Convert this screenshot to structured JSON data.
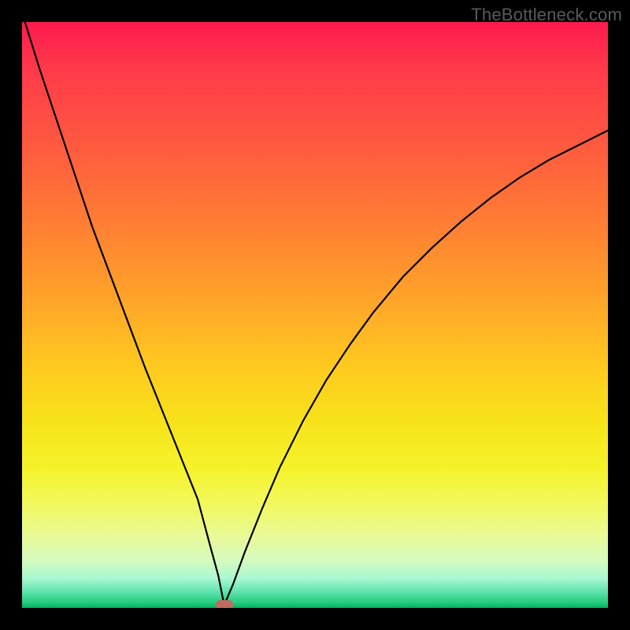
{
  "watermark": "TheBottleneck.com",
  "colors": {
    "frame": "#000000",
    "curve": "#000000",
    "marker": "#c06a62",
    "gradient_top": "#ff1a4d",
    "gradient_bottom": "#00b060"
  },
  "chart_data": {
    "type": "line",
    "title": "",
    "xlabel": "",
    "ylabel": "",
    "xlim": [
      0,
      100
    ],
    "ylim": [
      0,
      100
    ],
    "grid": false,
    "legend": false,
    "annotations": [
      {
        "type": "marker",
        "x": 34.5,
        "y": 0.5,
        "shape": "pill",
        "color": "#c06a62"
      }
    ],
    "series": [
      {
        "name": "bottleneck-curve",
        "color": "#000000",
        "x": [
          0.5,
          3,
          6,
          9,
          12,
          15,
          18,
          21,
          24,
          27,
          30,
          32,
          33.5,
          34.5,
          36,
          38,
          41,
          44,
          48,
          52,
          56,
          60,
          65,
          70,
          75,
          80,
          85,
          90,
          95,
          100
        ],
        "y": [
          100,
          92,
          83,
          74,
          65,
          57,
          49,
          41,
          33.5,
          26,
          18.5,
          11,
          5.5,
          0.5,
          4,
          9.5,
          17,
          24,
          32,
          39,
          45,
          50.5,
          56.5,
          61.5,
          66,
          70,
          73.5,
          76.5,
          79,
          81.5
        ]
      }
    ]
  }
}
